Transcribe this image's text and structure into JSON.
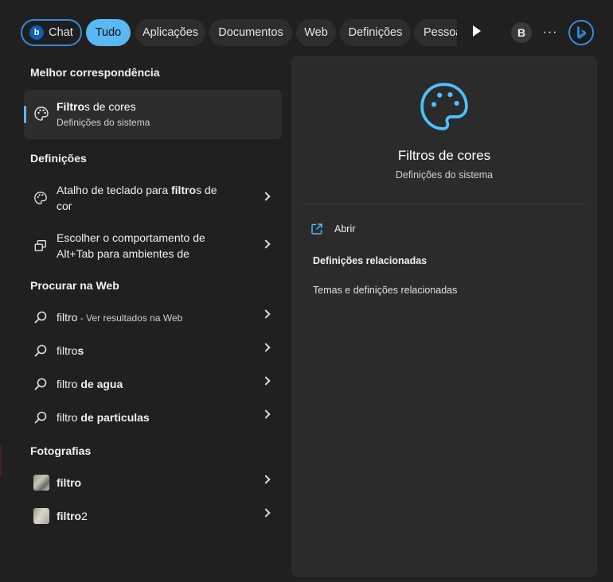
{
  "tabs": {
    "chat": "Chat",
    "bing_glyph": "b",
    "items": [
      "Tudo",
      "Aplicações",
      "Documentos",
      "Web",
      "Definições",
      "Pessoa"
    ],
    "avatar": "B",
    "more": "···"
  },
  "best_match": {
    "heading": "Melhor correspondência",
    "title_bold": "Filtro",
    "title_rest": "s de cores",
    "subtitle": "Definições do sistema"
  },
  "settings": {
    "heading": "Definições",
    "items": [
      {
        "pre": "Atalho de teclado para ",
        "bold": "filtro",
        "post": "s de",
        "line2": "cor"
      },
      {
        "pre": "Escolher o comportamento de",
        "bold": "",
        "post": "",
        "line2": "Alt+Tab para ambientes de"
      }
    ]
  },
  "web": {
    "heading": "Procurar na Web",
    "items": [
      {
        "pre": "filtro",
        "bold": "",
        "dim": " - Ver resultados na Web"
      },
      {
        "pre": "filtro",
        "bold": "s",
        "dim": ""
      },
      {
        "pre": "filtro",
        "bold": " de agua",
        "dim": ""
      },
      {
        "pre": "filtro",
        "bold": " de particulas",
        "dim": ""
      }
    ]
  },
  "photos": {
    "heading": "Fotografias",
    "items": [
      {
        "bold": "filtro",
        "rest": ""
      },
      {
        "bold": "filtro",
        "rest": "2"
      }
    ]
  },
  "detail": {
    "title": "Filtros de cores",
    "subtitle": "Definições do sistema",
    "open_label": "Abrir",
    "related_heading": "Definições relacionadas",
    "related_link": "Temas e definições relacionadas"
  },
  "colors": {
    "accent": "#5ab8f5",
    "panel": "#2b2b2b",
    "background": "#202020"
  }
}
